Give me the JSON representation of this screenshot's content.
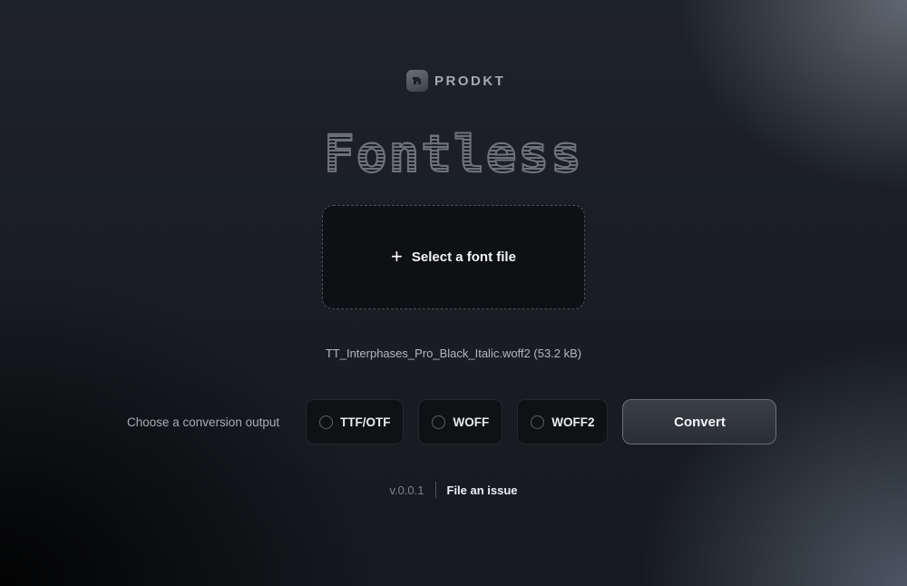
{
  "brand": {
    "name": "PRODKT",
    "logo_icon": "prodkt-logo-icon"
  },
  "title": "Fontless",
  "dropzone": {
    "icon": "plus-icon",
    "plus_glyph": "+",
    "label": "Select a font file"
  },
  "file": {
    "name": "TT_Interphases_Pro_Black_Italic.woff2 (53.2 kB)"
  },
  "conversion": {
    "caption": "Choose a conversion output",
    "options": [
      {
        "label": "TTF/OTF",
        "selected": false
      },
      {
        "label": "WOFF",
        "selected": false
      },
      {
        "label": "WOFF2",
        "selected": false
      }
    ],
    "convert_label": "Convert"
  },
  "footer": {
    "version": "v.0.0.1",
    "issue_link": "File an issue"
  }
}
